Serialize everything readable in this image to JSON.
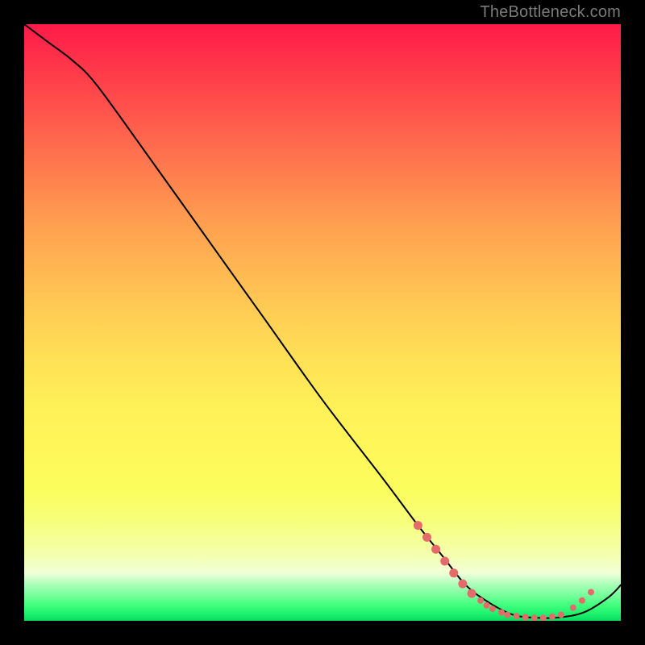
{
  "watermark": {
    "text": "TheBottleneck.com"
  },
  "chart_data": {
    "type": "line",
    "title": "",
    "xlabel": "",
    "ylabel": "",
    "xlim": [
      0,
      100
    ],
    "ylim": [
      0,
      100
    ],
    "grid": false,
    "legend": null,
    "series": [
      {
        "name": "bottleneck-curve",
        "x": [
          0,
          4,
          8,
          12,
          20,
          30,
          40,
          50,
          60,
          66,
          70,
          74,
          78,
          82,
          86,
          90,
          94,
          98,
          100
        ],
        "y": [
          100,
          97,
          94,
          90,
          79,
          65,
          51,
          37,
          24,
          16,
          11,
          6,
          3,
          1,
          0.5,
          0.6,
          1.5,
          4,
          6
        ],
        "color": "#000000",
        "stroke_width": 2
      }
    ],
    "markers": {
      "name": "overlay-dots",
      "color": "#e56a6a",
      "radius_small": 4,
      "radius_large": 5.5,
      "points": [
        {
          "x": 66.0,
          "y": 16.0,
          "r": "large"
        },
        {
          "x": 67.5,
          "y": 14.0,
          "r": "large"
        },
        {
          "x": 69.0,
          "y": 12.0,
          "r": "large"
        },
        {
          "x": 70.5,
          "y": 10.0,
          "r": "large"
        },
        {
          "x": 72.0,
          "y": 8.0,
          "r": "large"
        },
        {
          "x": 73.5,
          "y": 6.2,
          "r": "large"
        },
        {
          "x": 75.0,
          "y": 4.6,
          "r": "large"
        },
        {
          "x": 76.5,
          "y": 3.4,
          "r": "small"
        },
        {
          "x": 77.5,
          "y": 2.6,
          "r": "small"
        },
        {
          "x": 78.5,
          "y": 2.0,
          "r": "small"
        },
        {
          "x": 80.0,
          "y": 1.4,
          "r": "small"
        },
        {
          "x": 81.0,
          "y": 1.0,
          "r": "small"
        },
        {
          "x": 82.5,
          "y": 0.8,
          "r": "small"
        },
        {
          "x": 84.0,
          "y": 0.6,
          "r": "small"
        },
        {
          "x": 85.5,
          "y": 0.5,
          "r": "small"
        },
        {
          "x": 87.0,
          "y": 0.5,
          "r": "small"
        },
        {
          "x": 88.5,
          "y": 0.7,
          "r": "small"
        },
        {
          "x": 90.0,
          "y": 1.0,
          "r": "small"
        },
        {
          "x": 92.0,
          "y": 2.2,
          "r": "small"
        },
        {
          "x": 93.5,
          "y": 3.4,
          "r": "small"
        },
        {
          "x": 95.0,
          "y": 4.8,
          "r": "small"
        }
      ]
    },
    "background_gradient": {
      "direction": "vertical",
      "stops": [
        {
          "pos": 0.0,
          "color": "#ff1a48"
        },
        {
          "pos": 0.5,
          "color": "#ffd654"
        },
        {
          "pos": 0.8,
          "color": "#fcff62"
        },
        {
          "pos": 0.92,
          "color": "#f2ffd8"
        },
        {
          "pos": 1.0,
          "color": "#06d95c"
        }
      ]
    }
  }
}
